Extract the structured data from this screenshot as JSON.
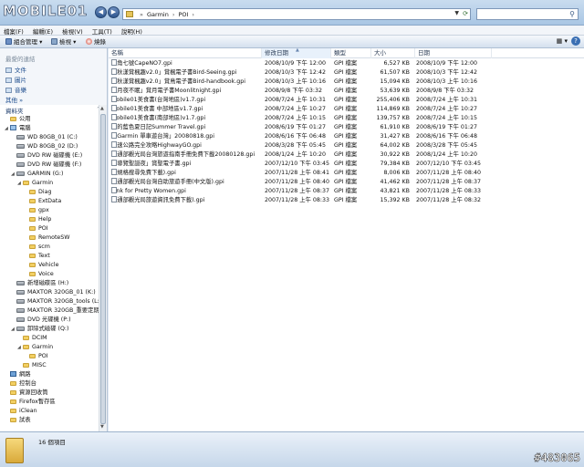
{
  "watermark_logo": "MOBILE01",
  "address": {
    "crumbs": [
      "Garmin",
      "POI"
    ],
    "refresh_icon": "refresh-icon"
  },
  "search": {
    "placeholder": "",
    "icon": "search-icon"
  },
  "menu": [
    "檔案(F)",
    "編輯(E)",
    "檢視(V)",
    "工具(T)",
    "說明(H)"
  ],
  "toolbar": {
    "organize": "組合管理",
    "views": "檢視",
    "burn": "燒錄"
  },
  "favorites": {
    "header": "最愛的連結",
    "links": [
      "文件",
      "圖片",
      "音樂"
    ],
    "more": "其他 »"
  },
  "folders_header": "資料夾",
  "tree": [
    {
      "label": "公用",
      "indent": 1,
      "icon": "folder"
    },
    {
      "label": "電腦",
      "indent": 1,
      "icon": "computer",
      "open": true
    },
    {
      "label": "WD 80GB_01 (C:)",
      "indent": 2,
      "icon": "drive"
    },
    {
      "label": "WD 80GB_02 (D:)",
      "indent": 2,
      "icon": "drive"
    },
    {
      "label": "DVD RW 磁碟機 (E:)",
      "indent": 2,
      "icon": "drive"
    },
    {
      "label": "DVD RW 磁碟機 (F:)",
      "indent": 2,
      "icon": "drive"
    },
    {
      "label": "GARMIN (G:)",
      "indent": 2,
      "icon": "drive",
      "open": true
    },
    {
      "label": "Garmin",
      "indent": 3,
      "icon": "folder",
      "open": true
    },
    {
      "label": "Diag",
      "indent": 4,
      "icon": "folder"
    },
    {
      "label": "ExtData",
      "indent": 4,
      "icon": "folder"
    },
    {
      "label": "gpx",
      "indent": 4,
      "icon": "folder"
    },
    {
      "label": "Help",
      "indent": 4,
      "icon": "folder"
    },
    {
      "label": "POI",
      "indent": 4,
      "icon": "folder"
    },
    {
      "label": "RemoteSW",
      "indent": 4,
      "icon": "folder"
    },
    {
      "label": "scm",
      "indent": 4,
      "icon": "folder"
    },
    {
      "label": "Text",
      "indent": 4,
      "icon": "folder"
    },
    {
      "label": "Vehicle",
      "indent": 4,
      "icon": "folder"
    },
    {
      "label": "Voice",
      "indent": 4,
      "icon": "folder"
    },
    {
      "label": "新增磁碟區 (H:)",
      "indent": 2,
      "icon": "drive"
    },
    {
      "label": "MAXTOR 320GB_01 (K:)",
      "indent": 2,
      "icon": "drive"
    },
    {
      "label": "MAXTOR 320GB_tools (L:)",
      "indent": 2,
      "icon": "drive"
    },
    {
      "label": "MAXTOR 320GB_重要定期備",
      "indent": 2,
      "icon": "drive"
    },
    {
      "label": "DVD 光碟機 (P:)",
      "indent": 2,
      "icon": "drive"
    },
    {
      "label": "卸除式磁碟 (Q:)",
      "indent": 2,
      "icon": "drive",
      "open": true
    },
    {
      "label": "DCIM",
      "indent": 3,
      "icon": "folder"
    },
    {
      "label": "Garmin",
      "indent": 3,
      "icon": "folder",
      "open": true
    },
    {
      "label": "POI",
      "indent": 4,
      "icon": "folder"
    },
    {
      "label": "MISC",
      "indent": 3,
      "icon": "folder"
    },
    {
      "label": "網路",
      "indent": 1,
      "icon": "network"
    },
    {
      "label": "控制台",
      "indent": 1,
      "icon": "folder"
    },
    {
      "label": "資源回收筒",
      "indent": 1,
      "icon": "folder"
    },
    {
      "label": "Firefox暫存區",
      "indent": 1,
      "icon": "folder"
    },
    {
      "label": "iClean",
      "indent": 1,
      "icon": "folder"
    },
    {
      "label": "試表",
      "indent": 1,
      "icon": "folder"
    }
  ],
  "columns": [
    "名稱",
    "修改日期",
    "類型",
    "大小",
    "日期"
  ],
  "files": [
    {
      "name": "海角七號CapeNO7.gpi",
      "modified": "2008/10/9 下午 12:00",
      "type": "GPI 檔案",
      "size": "6,527 KB",
      "date": "2008/10/9 下午 12:00"
    },
    {
      "name": "「秋漾賞楓趣v2.0」賞楓電子書Bird-Seeing.gpi",
      "modified": "2008/10/3 下午 12:42",
      "type": "GPI 檔案",
      "size": "61,507 KB",
      "date": "2008/10/3 下午 12:42"
    },
    {
      "name": "「秋漾賞楓趣v2.0」賞鳥電子書Bird-handbook.gpi",
      "modified": "2008/10/3 上午 10:16",
      "type": "GPI 檔案",
      "size": "15,094 KB",
      "date": "2008/10/3 上午 10:16"
    },
    {
      "name": "「月夜不眠」賞月電子書Moonlitnight.gpi",
      "modified": "2008/9/8 下午 03:32",
      "type": "GPI 檔案",
      "size": "53,639 KB",
      "date": "2008/9/8 下午 03:32"
    },
    {
      "name": "Mobile01美食書(台灣地區)v1.7.gpi",
      "modified": "2008/7/24 上午 10:31",
      "type": "GPI 檔案",
      "size": "255,406 KB",
      "date": "2008/7/24 上午 10:31"
    },
    {
      "name": "Mobile01美食書 中部地區v1.7.gpi",
      "modified": "2008/7/24 上午 10:27",
      "type": "GPI 檔案",
      "size": "114,869 KB",
      "date": "2008/7/24 上午 10:27"
    },
    {
      "name": "Mobile01美食書(南部地區)v1.7.gpi",
      "modified": "2008/7/24 上午 10:15",
      "type": "GPI 檔案",
      "size": "139,757 KB",
      "date": "2008/7/24 上午 10:15"
    },
    {
      "name": "我的藍色夏日記Summer Travel.gpi",
      "modified": "2008/6/19 下午 01:27",
      "type": "GPI 檔案",
      "size": "61,910 KB",
      "date": "2008/6/19 下午 01:27"
    },
    {
      "name": "「Garmin 單車遊台灣」20080818.gpi",
      "modified": "2008/6/16 下午 06:48",
      "type": "GPI 檔案",
      "size": "31,427 KB",
      "date": "2008/6/16 下午 06:48"
    },
    {
      "name": "高速公路完全攻略HighwayGO.gpi",
      "modified": "2008/3/28 下午 05:45",
      "type": "GPI 檔案",
      "size": "64,002 KB",
      "date": "2008/3/28 下午 05:45"
    },
    {
      "name": "交通部觀光局台灣旅遊指南手冊免費下載20080128.gpi",
      "modified": "2008/1/24 上午 10:20",
      "type": "GPI 檔案",
      "size": "30,922 KB",
      "date": "2008/1/24 上午 10:20"
    },
    {
      "name": "「導覽聖誕夜」賞聖電子書.gpi",
      "modified": "2007/12/10 下午 03:45",
      "type": "GPI 檔案",
      "size": "79,384 KB",
      "date": "2007/12/10 下午 03:45"
    },
    {
      "name": "高規格搜尋免費下載).gpi",
      "modified": "2007/11/28 上午 08:41",
      "type": "GPI 檔案",
      "size": "8,006 KB",
      "date": "2007/11/28 上午 08:40"
    },
    {
      "name": "交通部觀光局台灣自助旅遊手冊(中文版).gpi",
      "modified": "2007/11/28 上午 08:40",
      "type": "GPI 檔案",
      "size": "41,462 KB",
      "date": "2007/11/28 上午 08:37"
    },
    {
      "name": "Pink for Pretty Women.gpi",
      "modified": "2007/11/28 上午 08:37",
      "type": "GPI 檔案",
      "size": "43,821 KB",
      "date": "2007/11/28 上午 08:33"
    },
    {
      "name": "交通部觀光局旅遊資訊免費下載).gpi",
      "modified": "2007/11/28 上午 08:33",
      "type": "GPI 檔案",
      "size": "15,392 KB",
      "date": "2007/11/28 上午 08:32"
    }
  ],
  "status": {
    "item_count": "16 個項目"
  },
  "watermark_id": "#483065"
}
